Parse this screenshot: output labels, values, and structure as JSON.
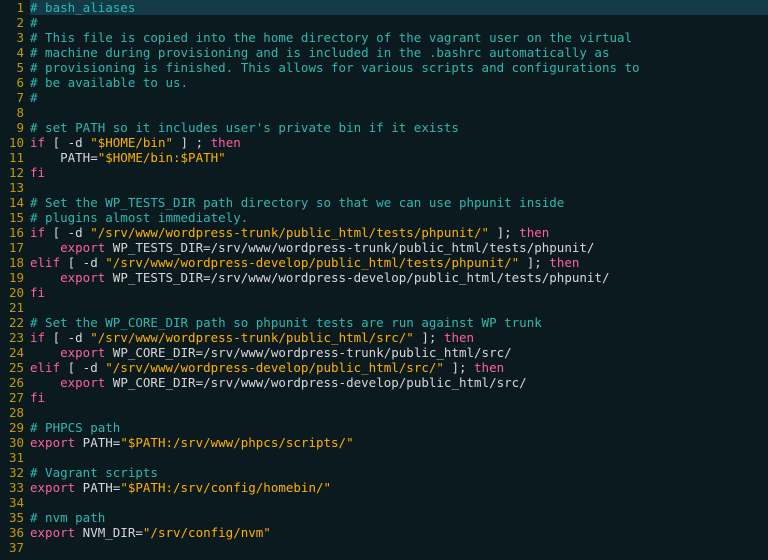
{
  "editor": {
    "total_lines": 37,
    "current_line": 1,
    "lines": [
      {
        "n": 1,
        "tokens": [
          {
            "cls": "tok-comment",
            "t": "# bash_aliases"
          }
        ]
      },
      {
        "n": 2,
        "tokens": [
          {
            "cls": "tok-comment",
            "t": "#"
          }
        ]
      },
      {
        "n": 3,
        "tokens": [
          {
            "cls": "tok-comment",
            "t": "# This file is copied into the home directory of the vagrant user on the virtual"
          }
        ]
      },
      {
        "n": 4,
        "tokens": [
          {
            "cls": "tok-comment",
            "t": "# machine during provisioning and is included in the .bashrc automatically as"
          }
        ]
      },
      {
        "n": 5,
        "tokens": [
          {
            "cls": "tok-comment",
            "t": "# provisioning is finished. This allows for various scripts and configurations to"
          }
        ]
      },
      {
        "n": 6,
        "tokens": [
          {
            "cls": "tok-comment",
            "t": "# be available to us."
          }
        ]
      },
      {
        "n": 7,
        "tokens": [
          {
            "cls": "tok-comment",
            "t": "#"
          }
        ]
      },
      {
        "n": 8,
        "tokens": [
          {
            "cls": "tok-default",
            "t": ""
          }
        ]
      },
      {
        "n": 9,
        "tokens": [
          {
            "cls": "tok-comment",
            "t": "# set PATH so it includes user's private bin if it exists"
          }
        ]
      },
      {
        "n": 10,
        "tokens": [
          {
            "cls": "tok-keyword",
            "t": "if"
          },
          {
            "cls": "tok-default",
            "t": " [ -d "
          },
          {
            "cls": "tok-string",
            "t": "\"$HOME/bin\""
          },
          {
            "cls": "tok-default",
            "t": " ] ; "
          },
          {
            "cls": "tok-keyword",
            "t": "then"
          }
        ]
      },
      {
        "n": 11,
        "tokens": [
          {
            "cls": "tok-default",
            "t": "    PATH="
          },
          {
            "cls": "tok-string",
            "t": "\"$HOME/bin:$PATH\""
          }
        ]
      },
      {
        "n": 12,
        "tokens": [
          {
            "cls": "tok-keyword",
            "t": "fi"
          }
        ]
      },
      {
        "n": 13,
        "tokens": [
          {
            "cls": "tok-default",
            "t": ""
          }
        ]
      },
      {
        "n": 14,
        "tokens": [
          {
            "cls": "tok-comment",
            "t": "# Set the WP_TESTS_DIR path directory so that we can use phpunit inside"
          }
        ]
      },
      {
        "n": 15,
        "tokens": [
          {
            "cls": "tok-comment",
            "t": "# plugins almost immediately."
          }
        ]
      },
      {
        "n": 16,
        "tokens": [
          {
            "cls": "tok-keyword",
            "t": "if"
          },
          {
            "cls": "tok-default",
            "t": " [ -d "
          },
          {
            "cls": "tok-string",
            "t": "\"/srv/www/wordpress-trunk/public_html/tests/phpunit/\""
          },
          {
            "cls": "tok-default",
            "t": " ]; "
          },
          {
            "cls": "tok-keyword",
            "t": "then"
          }
        ]
      },
      {
        "n": 17,
        "tokens": [
          {
            "cls": "tok-default",
            "t": "    "
          },
          {
            "cls": "tok-keyword",
            "t": "export"
          },
          {
            "cls": "tok-default",
            "t": " WP_TESTS_DIR=/srv/www/wordpress-trunk/public_html/tests/phpunit/"
          }
        ]
      },
      {
        "n": 18,
        "tokens": [
          {
            "cls": "tok-keyword",
            "t": "elif"
          },
          {
            "cls": "tok-default",
            "t": " [ -d "
          },
          {
            "cls": "tok-string",
            "t": "\"/srv/www/wordpress-develop/public_html/tests/phpunit/\""
          },
          {
            "cls": "tok-default",
            "t": " ]; "
          },
          {
            "cls": "tok-keyword",
            "t": "then"
          }
        ]
      },
      {
        "n": 19,
        "tokens": [
          {
            "cls": "tok-default",
            "t": "    "
          },
          {
            "cls": "tok-keyword",
            "t": "export"
          },
          {
            "cls": "tok-default",
            "t": " WP_TESTS_DIR=/srv/www/wordpress-develop/public_html/tests/phpunit/"
          }
        ]
      },
      {
        "n": 20,
        "tokens": [
          {
            "cls": "tok-keyword",
            "t": "fi"
          }
        ]
      },
      {
        "n": 21,
        "tokens": [
          {
            "cls": "tok-default",
            "t": ""
          }
        ]
      },
      {
        "n": 22,
        "tokens": [
          {
            "cls": "tok-comment",
            "t": "# Set the WP_CORE_DIR path so phpunit tests are run against WP trunk"
          }
        ]
      },
      {
        "n": 23,
        "tokens": [
          {
            "cls": "tok-keyword",
            "t": "if"
          },
          {
            "cls": "tok-default",
            "t": " [ -d "
          },
          {
            "cls": "tok-string",
            "t": "\"/srv/www/wordpress-trunk/public_html/src/\""
          },
          {
            "cls": "tok-default",
            "t": " ]; "
          },
          {
            "cls": "tok-keyword",
            "t": "then"
          }
        ]
      },
      {
        "n": 24,
        "tokens": [
          {
            "cls": "tok-default",
            "t": "    "
          },
          {
            "cls": "tok-keyword",
            "t": "export"
          },
          {
            "cls": "tok-default",
            "t": " WP_CORE_DIR=/srv/www/wordpress-trunk/public_html/src/"
          }
        ]
      },
      {
        "n": 25,
        "tokens": [
          {
            "cls": "tok-keyword",
            "t": "elif"
          },
          {
            "cls": "tok-default",
            "t": " [ -d "
          },
          {
            "cls": "tok-string",
            "t": "\"/srv/www/wordpress-develop/public_html/src/\""
          },
          {
            "cls": "tok-default",
            "t": " ]; "
          },
          {
            "cls": "tok-keyword",
            "t": "then"
          }
        ]
      },
      {
        "n": 26,
        "tokens": [
          {
            "cls": "tok-default",
            "t": "    "
          },
          {
            "cls": "tok-keyword",
            "t": "export"
          },
          {
            "cls": "tok-default",
            "t": " WP_CORE_DIR=/srv/www/wordpress-develop/public_html/src/"
          }
        ]
      },
      {
        "n": 27,
        "tokens": [
          {
            "cls": "tok-keyword",
            "t": "fi"
          }
        ]
      },
      {
        "n": 28,
        "tokens": [
          {
            "cls": "tok-default",
            "t": ""
          }
        ]
      },
      {
        "n": 29,
        "tokens": [
          {
            "cls": "tok-comment",
            "t": "# PHPCS path"
          }
        ]
      },
      {
        "n": 30,
        "tokens": [
          {
            "cls": "tok-keyword",
            "t": "export"
          },
          {
            "cls": "tok-default",
            "t": " PATH="
          },
          {
            "cls": "tok-string",
            "t": "\"$PATH:/srv/www/phpcs/scripts/\""
          }
        ]
      },
      {
        "n": 31,
        "tokens": [
          {
            "cls": "tok-default",
            "t": ""
          }
        ]
      },
      {
        "n": 32,
        "tokens": [
          {
            "cls": "tok-comment",
            "t": "# Vagrant scripts"
          }
        ]
      },
      {
        "n": 33,
        "tokens": [
          {
            "cls": "tok-keyword",
            "t": "export"
          },
          {
            "cls": "tok-default",
            "t": " PATH="
          },
          {
            "cls": "tok-string",
            "t": "\"$PATH:/srv/config/homebin/\""
          }
        ]
      },
      {
        "n": 34,
        "tokens": [
          {
            "cls": "tok-default",
            "t": ""
          }
        ]
      },
      {
        "n": 35,
        "tokens": [
          {
            "cls": "tok-comment",
            "t": "# nvm path"
          }
        ]
      },
      {
        "n": 36,
        "tokens": [
          {
            "cls": "tok-keyword",
            "t": "export"
          },
          {
            "cls": "tok-default",
            "t": " NVM_DIR="
          },
          {
            "cls": "tok-string",
            "t": "\"/srv/config/nvm\""
          }
        ]
      },
      {
        "n": 37,
        "tokens": [
          {
            "cls": "tok-default",
            "t": ""
          }
        ]
      }
    ]
  }
}
